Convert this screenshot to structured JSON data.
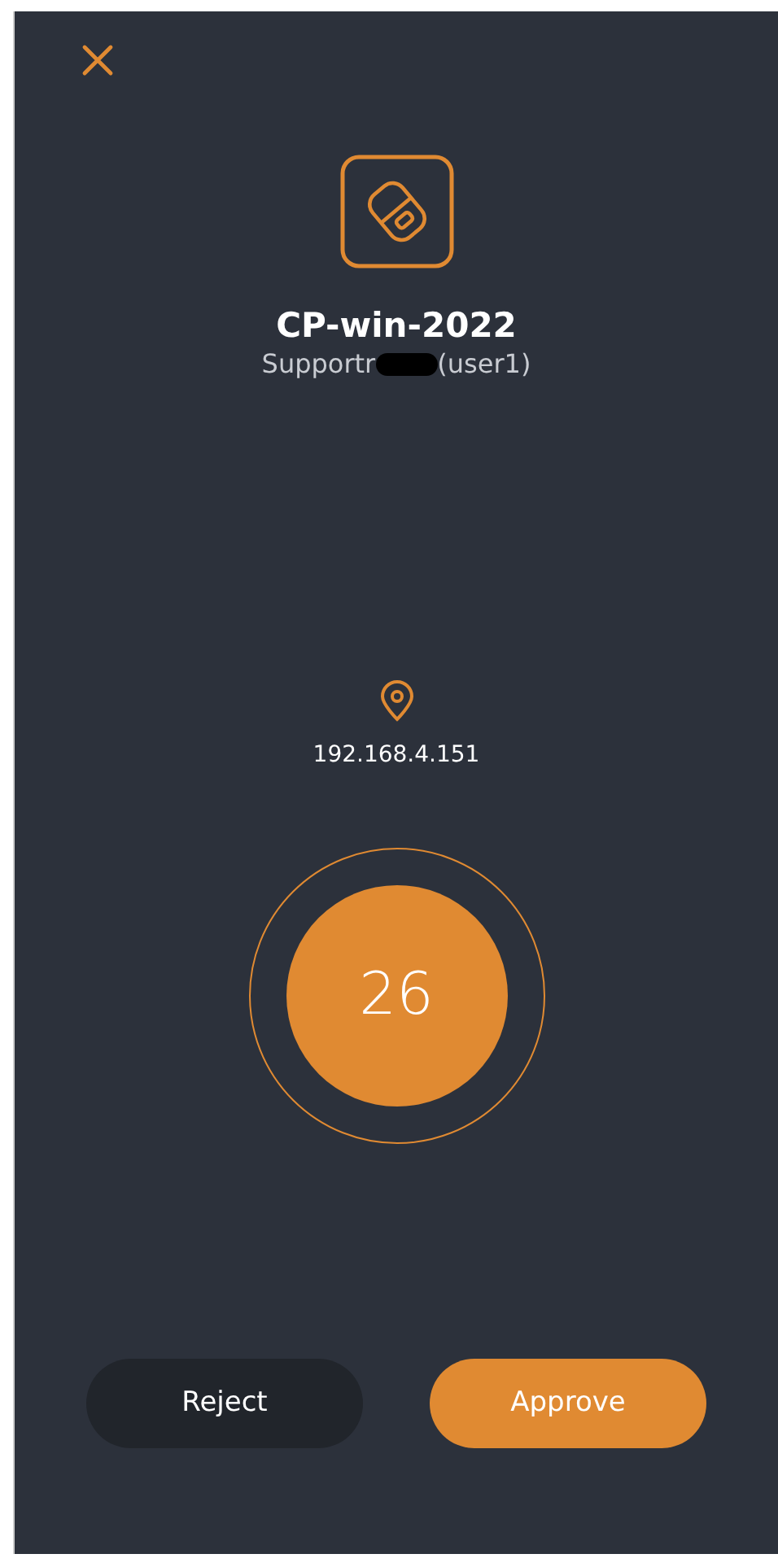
{
  "device": {
    "name": "CP-win-2022",
    "user_prefix": "Supportr",
    "user_redacted": true,
    "user_suffix": "(user1)"
  },
  "location": {
    "ip": "192.168.4.151"
  },
  "countdown": {
    "value": "26"
  },
  "buttons": [
    {
      "label": "Reject",
      "kind": "secondary"
    },
    {
      "label": "Approve",
      "kind": "primary"
    }
  ]
}
